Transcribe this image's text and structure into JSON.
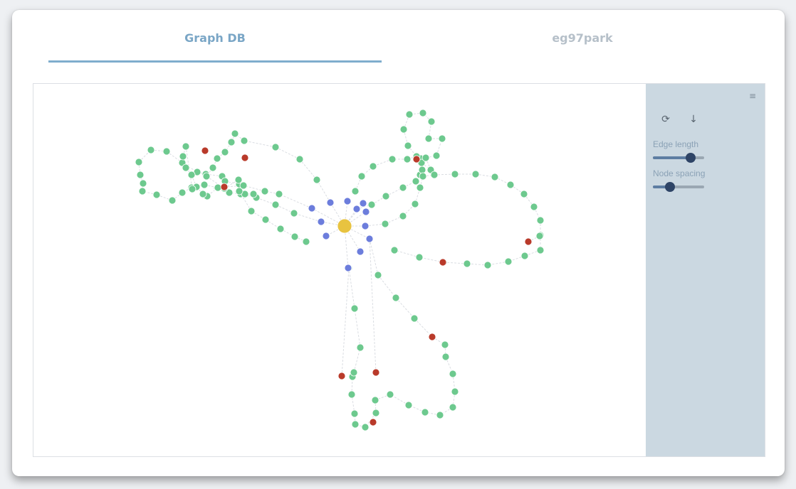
{
  "tabs": [
    {
      "label": "Graph DB",
      "active": true
    },
    {
      "label": "eg97park",
      "active": false
    }
  ],
  "toolbar": {
    "menu_icon": "hamburger-icon",
    "refresh_icon": "refresh-icon",
    "download_icon": "download-icon",
    "refresh_glyph": "⟳",
    "download_glyph": "↓",
    "menu_glyph": "≡"
  },
  "controls": {
    "edge_length": {
      "label": "Edge length",
      "value": 0.74
    },
    "node_spacing": {
      "label": "Node spacing",
      "value": 0.34
    }
  },
  "colors": {
    "center_node": "#e8c340",
    "blue_node": "#6c7ddc",
    "green_node": "#6dc98e",
    "red_node": "#b93a2a",
    "accent": "#7fadcd"
  },
  "graph": {
    "node_counts": {
      "center": 1,
      "blue": 12,
      "green": 150,
      "red": 10
    }
  }
}
